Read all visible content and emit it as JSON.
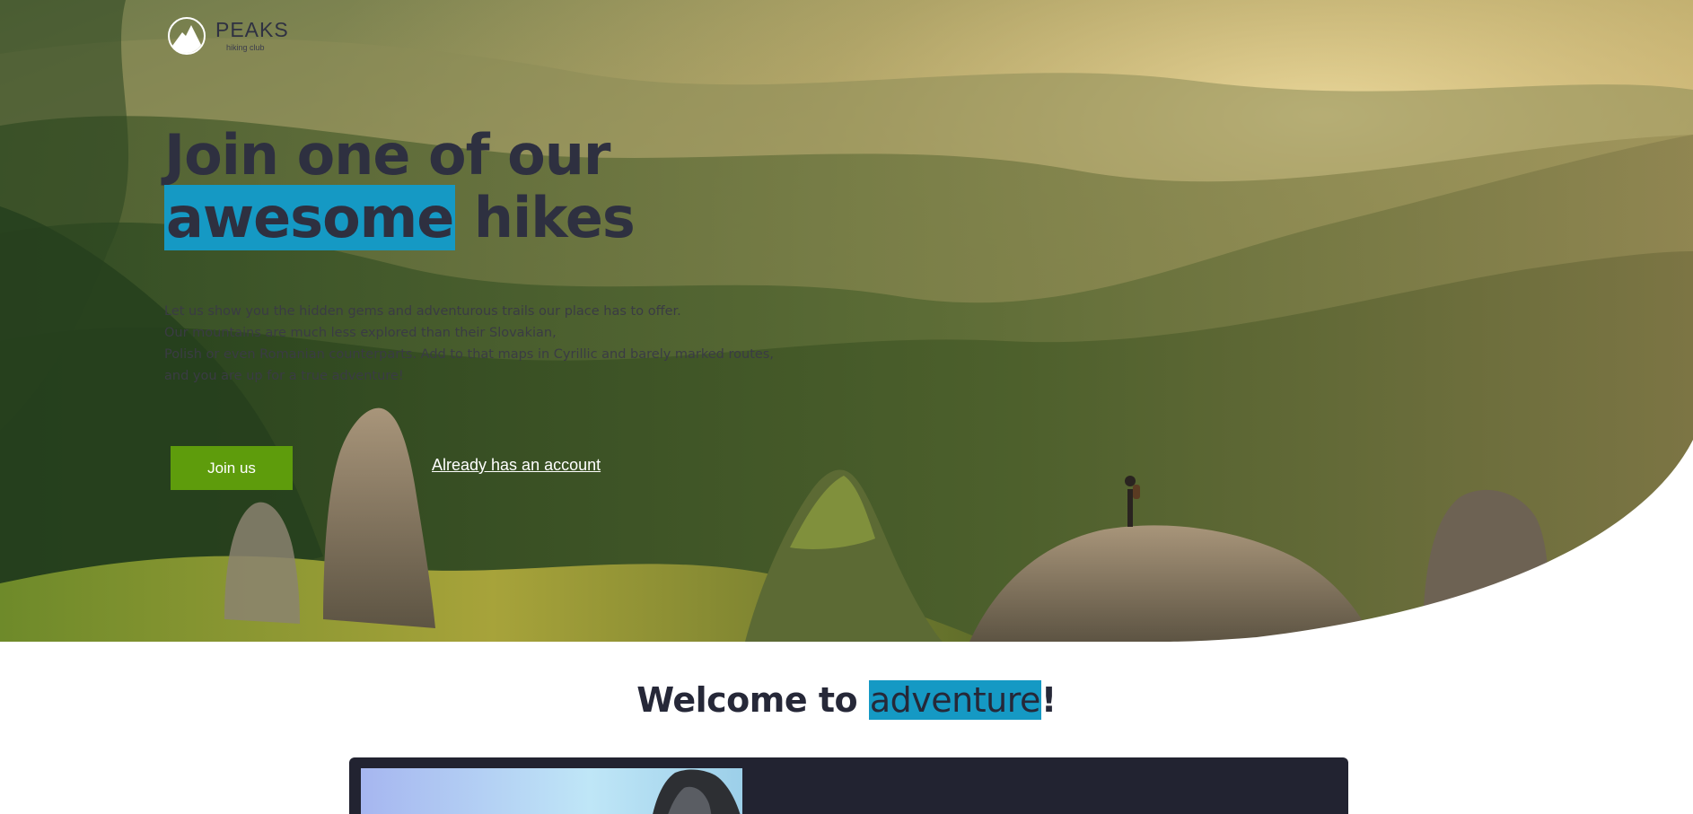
{
  "brand": {
    "name": "PEAKS",
    "tagline": "hiking club"
  },
  "hero": {
    "headline_line1": "Join one of our",
    "headline_highlight": "awesome",
    "headline_rest": " hikes",
    "intro_lines": [
      "Let us show you the hidden gems and adventurous trails our place has to offer.",
      "Our mountains are much less explored than their Slovakian,",
      "Polish or even Romanian counterparts. Add to that maps in Cyrillic and barely marked routes,",
      "and you are up for a true adventure!"
    ],
    "primary_button": "Join us",
    "secondary_link": "Already has an account"
  },
  "welcome": {
    "prefix": "Welcome to ",
    "highlight": "adventure",
    "suffix": "!"
  },
  "icons": {
    "logo": "mountain-logo-icon"
  },
  "colors": {
    "accent_highlight": "#1599c4",
    "button_green": "#5e9c0c",
    "text_dark": "#2e3040",
    "card_bg": "#222331"
  }
}
